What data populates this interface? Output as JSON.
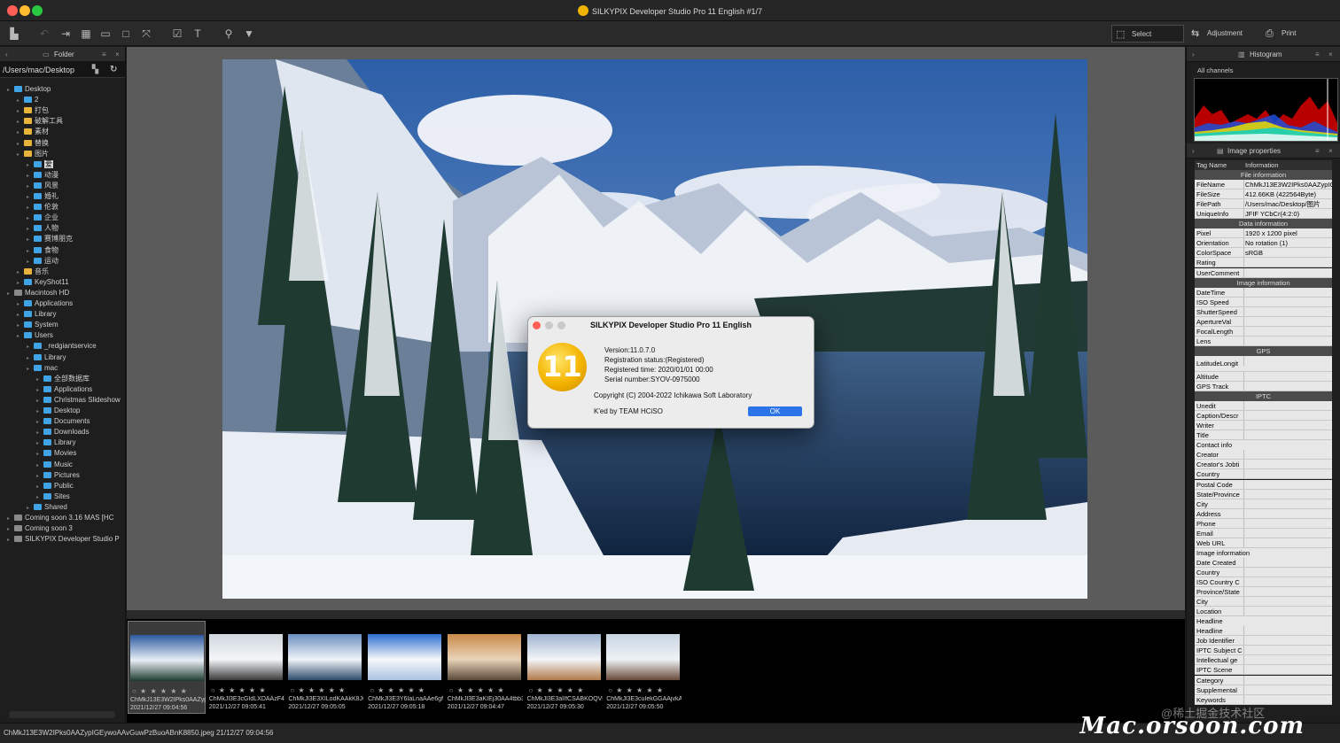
{
  "window": {
    "title": "SILKYPIX Developer Studio Pro 11 English   #1/7"
  },
  "toolbar": {
    "select": "Select",
    "adjustment": "Adjustment",
    "print": "Print"
  },
  "left_panel": {
    "title": "Folder",
    "path": "/Users/mac/Desktop",
    "tree": [
      {
        "label": "Desktop",
        "indent": 0,
        "color": "blue"
      },
      {
        "label": "2",
        "indent": 1,
        "color": "blue"
      },
      {
        "label": "打包",
        "indent": 1,
        "color": "yellow"
      },
      {
        "label": "破解工具",
        "indent": 1,
        "color": "yellow"
      },
      {
        "label": "素材",
        "indent": 1,
        "color": "yellow"
      },
      {
        "label": "替换",
        "indent": 1,
        "color": "yellow"
      },
      {
        "label": "图片",
        "indent": 1,
        "color": "yellow"
      },
      {
        "label": "爱",
        "indent": 2,
        "color": "blue",
        "selected": true
      },
      {
        "label": "动漫",
        "indent": 2,
        "color": "blue"
      },
      {
        "label": "风景",
        "indent": 2,
        "color": "blue"
      },
      {
        "label": "婚礼",
        "indent": 2,
        "color": "blue"
      },
      {
        "label": "伦敦",
        "indent": 2,
        "color": "blue"
      },
      {
        "label": "企业",
        "indent": 2,
        "color": "blue"
      },
      {
        "label": "人物",
        "indent": 2,
        "color": "blue"
      },
      {
        "label": "赛博朋克",
        "indent": 2,
        "color": "blue"
      },
      {
        "label": "食物",
        "indent": 2,
        "color": "blue"
      },
      {
        "label": "运动",
        "indent": 2,
        "color": "blue"
      },
      {
        "label": "音乐",
        "indent": 1,
        "color": "yellow"
      },
      {
        "label": "KeyShot11",
        "indent": 1,
        "color": "blue"
      },
      {
        "label": "Macintosh HD",
        "indent": 0,
        "color": "gray"
      },
      {
        "label": "Applications",
        "indent": 1,
        "color": "blue"
      },
      {
        "label": "Library",
        "indent": 1,
        "color": "blue"
      },
      {
        "label": "System",
        "indent": 1,
        "color": "blue"
      },
      {
        "label": "Users",
        "indent": 1,
        "color": "blue"
      },
      {
        "label": "_redgiantservice",
        "indent": 2,
        "color": "blue"
      },
      {
        "label": "Library",
        "indent": 2,
        "color": "blue"
      },
      {
        "label": "mac",
        "indent": 2,
        "color": "blue"
      },
      {
        "label": "全部数据库",
        "indent": 3,
        "color": "blue"
      },
      {
        "label": "Applications",
        "indent": 3,
        "color": "blue"
      },
      {
        "label": "Christmas Slideshow",
        "indent": 3,
        "color": "blue"
      },
      {
        "label": "Desktop",
        "indent": 3,
        "color": "blue"
      },
      {
        "label": "Documents",
        "indent": 3,
        "color": "blue"
      },
      {
        "label": "Downloads",
        "indent": 3,
        "color": "blue"
      },
      {
        "label": "Library",
        "indent": 3,
        "color": "blue"
      },
      {
        "label": "Movies",
        "indent": 3,
        "color": "blue"
      },
      {
        "label": "Music",
        "indent": 3,
        "color": "blue"
      },
      {
        "label": "Pictures",
        "indent": 3,
        "color": "blue"
      },
      {
        "label": "Public",
        "indent": 3,
        "color": "blue"
      },
      {
        "label": "Sites",
        "indent": 3,
        "color": "blue"
      },
      {
        "label": "Shared",
        "indent": 2,
        "color": "blue"
      },
      {
        "label": "Coming soon 3.16 MAS [HC",
        "indent": 0,
        "color": "gray"
      },
      {
        "label": "Coming soon 3",
        "indent": 0,
        "color": "gray"
      },
      {
        "label": "SILKYPIX Developer Studio P",
        "indent": 0,
        "color": "gray"
      }
    ]
  },
  "dialog": {
    "title": "SILKYPIX Developer Studio Pro 11 English",
    "logo_text": "11",
    "version": "Version:11.0.7.0",
    "registration": "Registration status:(Registered)",
    "registered_time": "Registered time: 2020/01/01 00:00",
    "serial": "Serial number:SYOV-0975000",
    "copyright": "Copyright (C) 2004-2022 Ichikawa Soft Laboratory",
    "cracked": "K'ed by TEAM HCiSO",
    "ok": "OK"
  },
  "filmstrip": [
    {
      "name": "ChMkJ13E3W2IPks0AAZypIGEywoAAvGuwPzBuoABnK8850.jpeg",
      "date": "2021/12/27 09:04:56",
      "stars": "○ ★ ★ ★ ★ ★",
      "selected": true
    },
    {
      "name": "ChMkJl3E3cGIdLXDAAzF4qf",
      "date": "2021/12/27 09:05:41",
      "stars": "○ ★ ★ ★ ★ ★"
    },
    {
      "name": "ChMkJl3E3XILodKAAkK8JC",
      "date": "2021/12/27 09:05:05",
      "stars": "○ ★ ★ ★ ★ ★"
    },
    {
      "name": "ChMkJl3E3Y6IaLnaAAe6gMf",
      "date": "2021/12/27 09:05:18",
      "stars": "○ ★ ★ ★ ★ ★"
    },
    {
      "name": "ChMkJl3E3aKIEj30AA4tbb3",
      "date": "2021/12/27 09:04:47",
      "stars": "○ ★ ★ ★ ★ ★"
    },
    {
      "name": "ChMkJl3E3aIIfCSABKOQVNI",
      "date": "2021/12/27 09:05:30",
      "stars": "○ ★ ★ ★ ★ ★"
    },
    {
      "name": "ChMkJl3E3cuIekGGAAjvkA-c",
      "date": "2021/12/27 09:05:50",
      "stars": "○ ★ ★ ★ ★ ★"
    }
  ],
  "status": {
    "text": "ChMkJ13E3W2IPks0AAZypIGEywoAAvGuwPzBuoABnK8850.jpeg 21/12/27 09:04:56"
  },
  "watermark": {
    "main": "Mac.orsoon.com",
    "secondary": "@稀土掘金技术社区"
  },
  "right_panel": {
    "histogram_title": "Histogram",
    "histogram_channel": "All channels",
    "props_title": "Image properties",
    "header": {
      "tag": "Tag Name",
      "info": "Information"
    },
    "rows": [
      {
        "type": "sec",
        "label": "File information"
      },
      {
        "type": "data",
        "k": "FileName",
        "v": "ChMkJ13E3W2IPks0AAZypIGEywoAAvGuwPzBuoABnK8850.jpeg"
      },
      {
        "type": "data",
        "k": "FileSize",
        "v": "412.66KB (422564Byte)"
      },
      {
        "type": "data",
        "k": "FilePath",
        "v": "/Users/mac/Desktop/图片"
      },
      {
        "type": "data",
        "k": "UniqueInfo",
        "v": "JFIF YCbCr(4:2:0)"
      },
      {
        "type": "sec",
        "label": "Data information"
      },
      {
        "type": "data",
        "k": "Pixel",
        "v": "1920 x 1200 pixel"
      },
      {
        "type": "data",
        "k": "Orientation",
        "v": "No rotation (1)"
      },
      {
        "type": "data",
        "k": "ColorSpace",
        "v": "sRGB"
      },
      {
        "type": "data",
        "k": "Rating",
        "v": ""
      },
      {
        "type": "data",
        "k": "UserComment",
        "v": ""
      },
      {
        "type": "sec",
        "label": "Image information"
      },
      {
        "type": "data",
        "k": "DateTime",
        "v": ""
      },
      {
        "type": "data",
        "k": "ISO Speed",
        "v": ""
      },
      {
        "type": "data",
        "k": "ShutterSpeed",
        "v": ""
      },
      {
        "type": "data",
        "k": "ApertureVal",
        "v": ""
      },
      {
        "type": "data",
        "k": "FocalLength",
        "v": ""
      },
      {
        "type": "data",
        "k": "Lens",
        "v": ""
      },
      {
        "type": "sec",
        "label": "GPS"
      },
      {
        "type": "data",
        "k": "LatitudeLongit",
        "v": "",
        "tall": true
      },
      {
        "type": "data",
        "k": "Altitude",
        "v": ""
      },
      {
        "type": "data",
        "k": "GPS Track",
        "v": ""
      },
      {
        "type": "sec",
        "label": "IPTC"
      },
      {
        "type": "data",
        "k": "Unedit",
        "v": ""
      },
      {
        "type": "data",
        "k": "Caption/Descr",
        "v": ""
      },
      {
        "type": "data",
        "k": "Writer",
        "v": ""
      },
      {
        "type": "data",
        "k": "Title",
        "v": ""
      },
      {
        "type": "sub",
        "label": "Contact info"
      },
      {
        "type": "data",
        "k": "Creator",
        "v": ""
      },
      {
        "type": "data",
        "k": "Creator's Jobti",
        "v": ""
      },
      {
        "type": "data",
        "k": "Country",
        "v": ""
      },
      {
        "type": "data",
        "k": "Postal Code",
        "v": ""
      },
      {
        "type": "data",
        "k": "State/Province",
        "v": ""
      },
      {
        "type": "data",
        "k": "City",
        "v": ""
      },
      {
        "type": "data",
        "k": "Address",
        "v": ""
      },
      {
        "type": "data",
        "k": "Phone",
        "v": ""
      },
      {
        "type": "data",
        "k": "Email",
        "v": ""
      },
      {
        "type": "data",
        "k": "Web URL",
        "v": ""
      },
      {
        "type": "sub",
        "label": "Image information"
      },
      {
        "type": "data",
        "k": "Date Created",
        "v": ""
      },
      {
        "type": "data",
        "k": "Country",
        "v": ""
      },
      {
        "type": "data",
        "k": "ISO Country C",
        "v": ""
      },
      {
        "type": "data",
        "k": "Province/State",
        "v": ""
      },
      {
        "type": "data",
        "k": "City",
        "v": ""
      },
      {
        "type": "data",
        "k": "Location",
        "v": ""
      },
      {
        "type": "sub",
        "label": "Headline"
      },
      {
        "type": "data",
        "k": "Headline",
        "v": ""
      },
      {
        "type": "data",
        "k": "Job Identifier",
        "v": ""
      },
      {
        "type": "data",
        "k": "IPTC Subject C",
        "v": ""
      },
      {
        "type": "data",
        "k": "Intellectual ge",
        "v": ""
      },
      {
        "type": "data",
        "k": "IPTC Scene",
        "v": ""
      },
      {
        "type": "data",
        "k": "Category",
        "v": ""
      },
      {
        "type": "data",
        "k": "Supplemental",
        "v": ""
      },
      {
        "type": "data",
        "k": "Keywords",
        "v": ""
      }
    ]
  },
  "colors": {
    "accent": "#2a73e8",
    "folder_blue": "#3fa3e6",
    "folder_yellow": "#e7b33a"
  },
  "icons": [
    "folder-icon",
    "histogram-icon",
    "select-icon",
    "adjustment-icon",
    "print-icon",
    "filter-icon"
  ]
}
